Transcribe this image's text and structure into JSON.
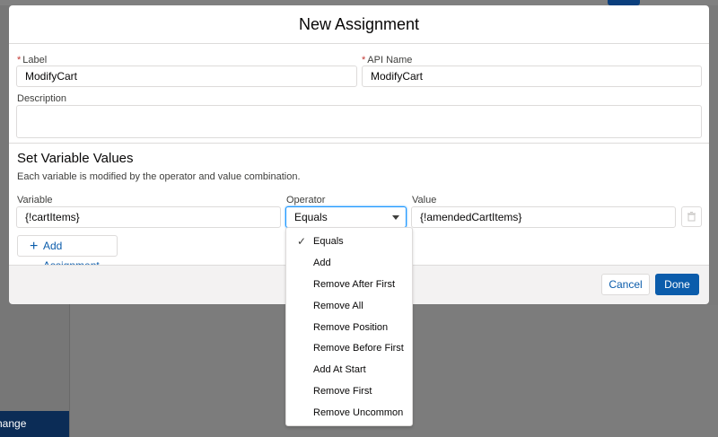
{
  "modal": {
    "title": "New Assignment",
    "label_field": {
      "label": "Label",
      "required_mark": "*",
      "value": "ModifyCart"
    },
    "api_name_field": {
      "label": "API Name",
      "required_mark": "*",
      "value": "ModifyCart"
    },
    "description_field": {
      "label": "Description",
      "value": ""
    },
    "section": {
      "title": "Set Variable Values",
      "description": "Each variable is modified by the operator and value combination."
    },
    "assignment": {
      "variable_label": "Variable",
      "variable_value": "{!cartItems}",
      "operator_label": "Operator",
      "operator_value": "Equals",
      "value_label": "Value",
      "value_value": "{!amendedCartItems}"
    },
    "add_assignment_label": "Add Assignment",
    "cancel_label": "Cancel",
    "done_label": "Done"
  },
  "operator_options": [
    {
      "label": "Equals",
      "selected": true
    },
    {
      "label": "Add"
    },
    {
      "label": "Remove After First"
    },
    {
      "label": "Remove All"
    },
    {
      "label": "Remove Position"
    },
    {
      "label": "Remove Before First"
    },
    {
      "label": "Add At Start"
    },
    {
      "label": "Remove First"
    },
    {
      "label": "Remove Uncommon"
    }
  ],
  "background": {
    "change_label": "hange"
  },
  "colors": {
    "accent": "#0b5cab",
    "focus": "#1b96ff",
    "required": "#c23934"
  },
  "icons": {
    "check": "check-icon",
    "plus": "plus-icon",
    "trash": "trash-icon",
    "dropdown": "chevron-down-icon"
  }
}
